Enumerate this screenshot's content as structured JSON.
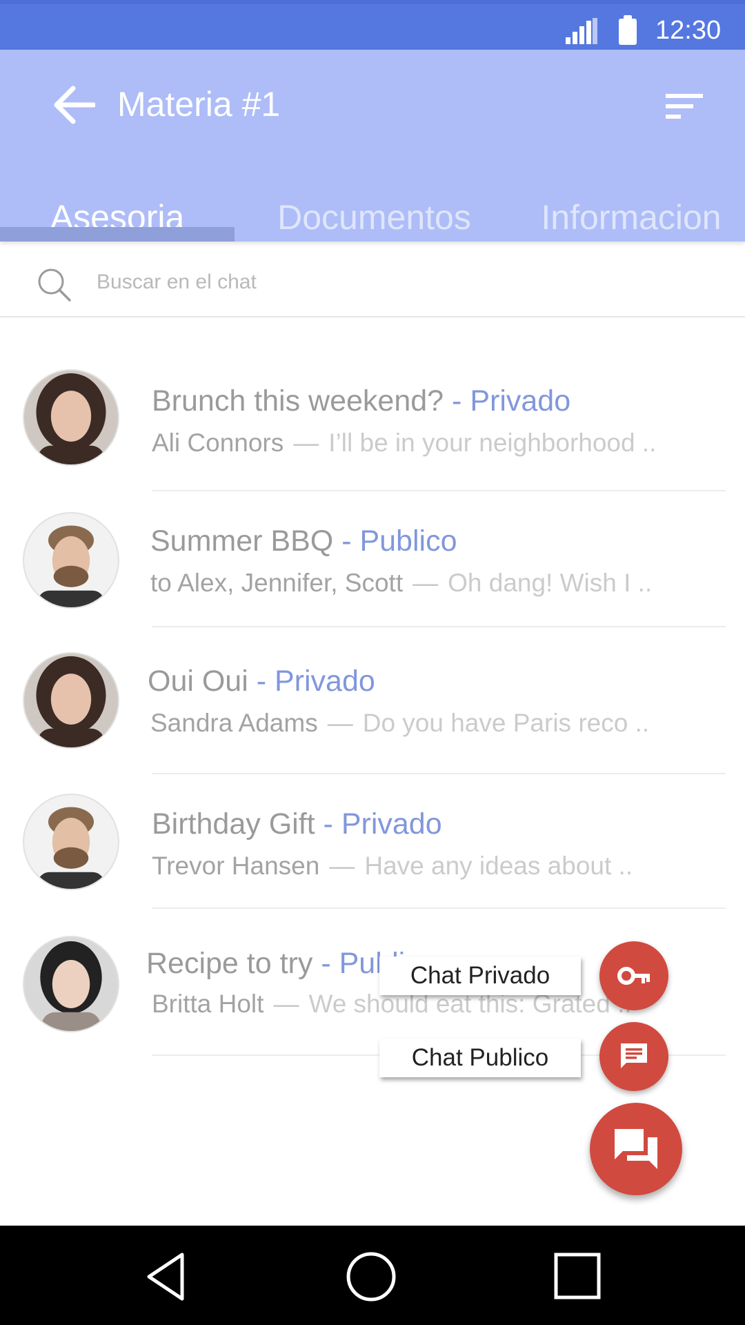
{
  "status_bar": {
    "time": "12:30",
    "signal_icon": "signal-icon",
    "battery_icon": "battery-icon"
  },
  "app_bar": {
    "title": "Materia #1",
    "back_icon": "arrow-back-icon",
    "sort_icon": "sort-icon"
  },
  "tabs": [
    {
      "label": "Asesoria",
      "active": true
    },
    {
      "label": "Documentos",
      "active": false
    },
    {
      "label": "Informacion",
      "active": false
    }
  ],
  "search": {
    "placeholder": "Buscar en el chat",
    "value": ""
  },
  "chats": [
    {
      "subject": "Brunch this weekend?",
      "kind": "- Privado",
      "sender": "Ali Connors",
      "preview": "I’ll be in your neighborhood ..",
      "avatar": "woman-curly-hair"
    },
    {
      "subject": "Summer BBQ",
      "kind": "- Publico",
      "sender": "to Alex, Jennifer, Scott",
      "preview": "Oh dang! Wish I ..",
      "avatar": "man-beard"
    },
    {
      "subject": "Oui Oui",
      "kind": "- Privado",
      "sender": "Sandra Adams",
      "preview": "Do you have Paris reco ..",
      "avatar": "woman-curly-hair"
    },
    {
      "subject": "Birthday Gift",
      "kind": "- Privado",
      "sender": "Trevor Hansen",
      "preview": "Have any ideas about ..",
      "avatar": "man-beard"
    },
    {
      "subject": "Recipe to try",
      "kind": "- Publico",
      "sender": "Britta Holt",
      "preview": "We should eat this: Grated ..",
      "avatar": "woman-straight-hair"
    }
  ],
  "fab_menu": {
    "private_label": "Chat Privado",
    "public_label": "Chat Publico",
    "private_icon": "key-icon",
    "public_icon": "message-icon",
    "main_icon": "forum-icon"
  },
  "nav_bar": {
    "back_icon": "nav-back-icon",
    "home_icon": "nav-home-icon",
    "recents_icon": "nav-recents-icon"
  },
  "colors": {
    "status_bar": "#5577e0",
    "app_bar": "#aebdf8",
    "accent_text": "#8197dc",
    "fab": "#d14a3f"
  }
}
